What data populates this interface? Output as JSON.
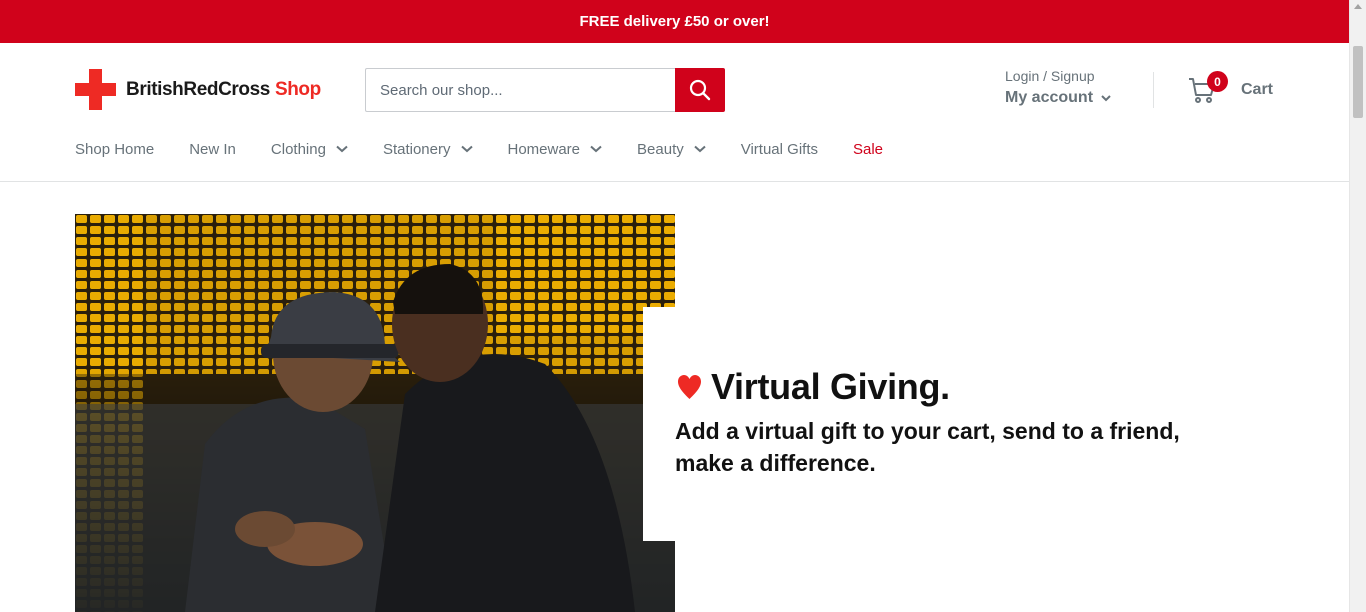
{
  "announcement": {
    "text": "FREE delivery £50 or over!"
  },
  "brand": {
    "name": "BritishRedCross",
    "shop": "Shop"
  },
  "search": {
    "placeholder": "Search our shop..."
  },
  "account": {
    "login_label": "Login / Signup",
    "account_label": "My account"
  },
  "cart": {
    "count": "0",
    "label": "Cart"
  },
  "nav": {
    "items": [
      {
        "label": "Shop Home"
      },
      {
        "label": "New In"
      },
      {
        "label": "Clothing"
      },
      {
        "label": "Stationery"
      },
      {
        "label": "Homeware"
      },
      {
        "label": "Beauty"
      },
      {
        "label": "Virtual Gifts"
      },
      {
        "label": "Sale"
      }
    ]
  },
  "hero": {
    "title": "Virtual Giving.",
    "subtitle": "Add a virtual gift to your cart, send to a friend, make a difference."
  },
  "colors": {
    "brand_red": "#d0021b",
    "logo_red": "#ee2a24",
    "nav_text": "#677279"
  }
}
